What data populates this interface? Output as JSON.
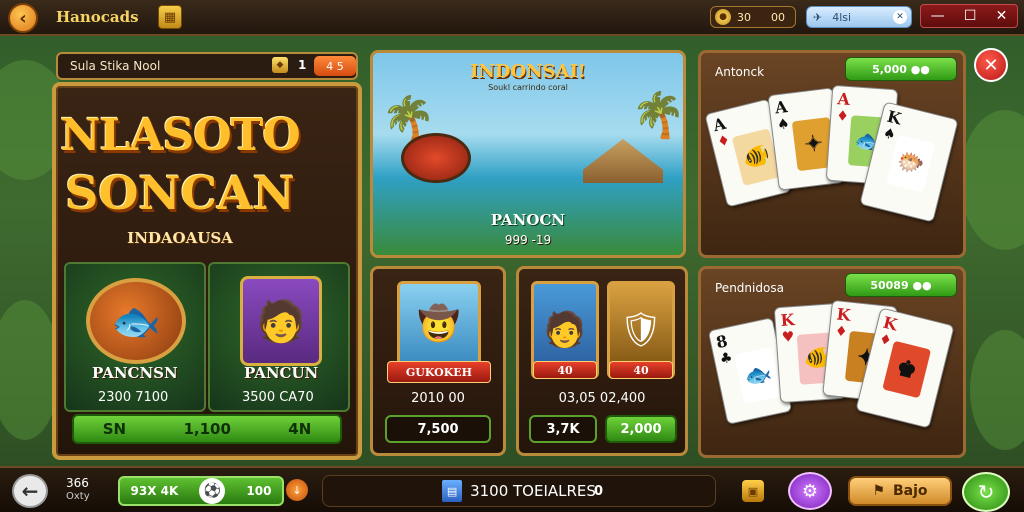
{
  "topbar": {
    "back_icon": "chevron-left-icon",
    "title": "Hanocads",
    "grid_icon": "grid-icon",
    "coins_value": "30",
    "coins_extra": "00",
    "plane_value": "4lsi",
    "window": {
      "minimize": "—",
      "maximize": "☐",
      "close": "✕"
    }
  },
  "left": {
    "header_label": "Sula Stika Nool",
    "header_count": "1",
    "header_badge": "4 5",
    "logo_line1": "NLASOTO",
    "logo_line2": "SONCAN",
    "logo_sub": "INDAOAUSA",
    "char1": {
      "name": "PANCNSN",
      "value": "2300 7100"
    },
    "char2": {
      "name": "PANCUN",
      "value": "3500 CA70"
    },
    "bar": [
      "SN",
      "1,100",
      "4N"
    ]
  },
  "scene": {
    "title": "INDONSAI!",
    "subtitle": "Soukl carrindo coral",
    "name": "PANOCN",
    "value": "999 -19"
  },
  "mini1": {
    "ribbon": "GUKOKEH",
    "value": "2010 00",
    "button": "7,500"
  },
  "mini2": {
    "ribbon1": "40",
    "ribbon2": "40",
    "value": "03,05 02,400",
    "button1": "3,7K",
    "button2": "2,000"
  },
  "cards1": {
    "title": "Antonck",
    "pill": "5,000 ●●"
  },
  "cards2": {
    "title": "Pendnidosa",
    "pill": "50089 ●●"
  },
  "bottom": {
    "stat1": "366",
    "stat2": "Oxty",
    "green_left": "93X 4K",
    "green_right": "100",
    "center_text": "3100 TOEIALRES",
    "center_count": "0",
    "bajo": "Bajo"
  },
  "colors": {
    "gold": "#ffbe2a",
    "green": "#2f8a12",
    "frame": "#c99a3e",
    "close_red": "#b81818"
  }
}
